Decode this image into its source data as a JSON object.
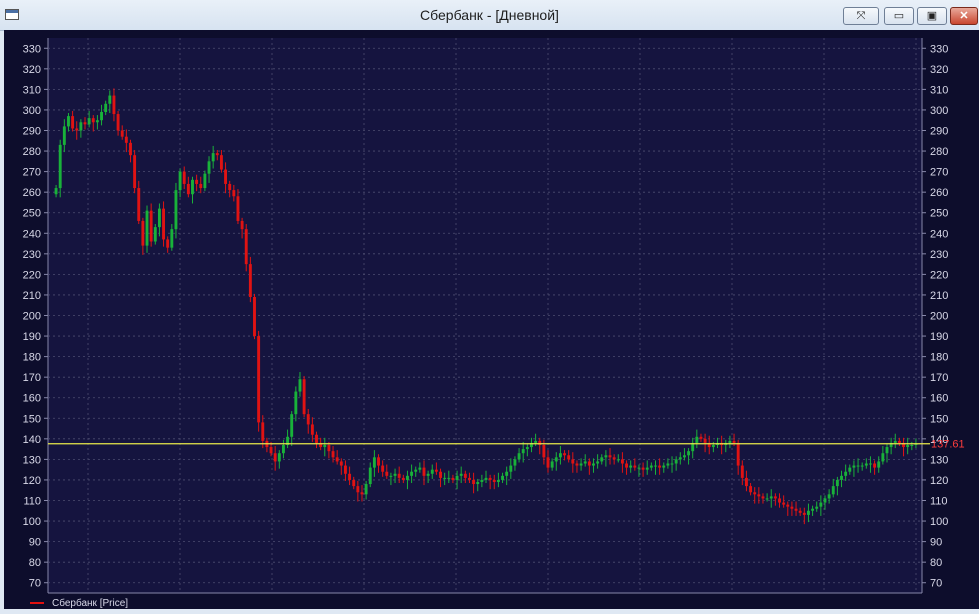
{
  "window": {
    "title": "Сбербанк  - [Дневной]"
  },
  "titlebar_buttons": {
    "restore_symbol": "⤧",
    "minimize_symbol": "▭",
    "maximize_symbol": "▣",
    "close_symbol": "✕"
  },
  "legend": {
    "label": "Сбербанк [Price]",
    "color": "#e01010"
  },
  "chart_data": {
    "type": "candlestick",
    "ylim": [
      65,
      335
    ],
    "yticks": [
      70,
      80,
      90,
      100,
      110,
      120,
      130,
      140,
      150,
      160,
      170,
      180,
      190,
      200,
      210,
      220,
      230,
      240,
      250,
      260,
      270,
      280,
      290,
      300,
      310,
      320,
      330
    ],
    "last_price": {
      "value": 137.61,
      "label": "137.61"
    },
    "colors": {
      "up": "#19b23a",
      "down": "#e01313",
      "last_price_line": "#e8e84a",
      "last_price_label": "#ff3c3c",
      "grid": "#4d4d70",
      "axis_text": "#d8d8e8"
    },
    "series": [
      {
        "name": "Сбербанк [Price]",
        "close": [
          262,
          283,
          292,
          297,
          291,
          290,
          294,
          293,
          296,
          294,
          295,
          299,
          303,
          307,
          298,
          290,
          287,
          284,
          278,
          262,
          246,
          234,
          251,
          236,
          243,
          252,
          237,
          233,
          242,
          261,
          270,
          264,
          259,
          266,
          264,
          262,
          269,
          275,
          279,
          278,
          271,
          264,
          261,
          258,
          246,
          242,
          225,
          209,
          190,
          148,
          139,
          136,
          133,
          129,
          133,
          137,
          141,
          152,
          163,
          169,
          152,
          147,
          142,
          138,
          136,
          137,
          134,
          131,
          129,
          127,
          123,
          120,
          117,
          114,
          113,
          118,
          126,
          131,
          127,
          124,
          122,
          122,
          123,
          121,
          120,
          122,
          124,
          125,
          126,
          122,
          123,
          125,
          124,
          121,
          121,
          121,
          120,
          122,
          123,
          121,
          120,
          118,
          119,
          120,
          121,
          120,
          119,
          120,
          122,
          124,
          127,
          130,
          133,
          135,
          136,
          138,
          139,
          137,
          131,
          126,
          129,
          131,
          133,
          132,
          130,
          128,
          127,
          128,
          129,
          127,
          128,
          129,
          131,
          132,
          131,
          130,
          130,
          128,
          126,
          127,
          126,
          126,
          125,
          126,
          127,
          127,
          126,
          127,
          128,
          128,
          130,
          131,
          132,
          134,
          138,
          141,
          140,
          138,
          136,
          137,
          138,
          137,
          138,
          139,
          138,
          127,
          121,
          117,
          114,
          113,
          112,
          111,
          111,
          112,
          111,
          109,
          108,
          107,
          106,
          105,
          104,
          103,
          105,
          106,
          107,
          109,
          111,
          113,
          117,
          120,
          122,
          124,
          126,
          127,
          127,
          127,
          128,
          128,
          126,
          129,
          133,
          136,
          138,
          139,
          138,
          136,
          137,
          137,
          137.61
        ]
      }
    ]
  }
}
